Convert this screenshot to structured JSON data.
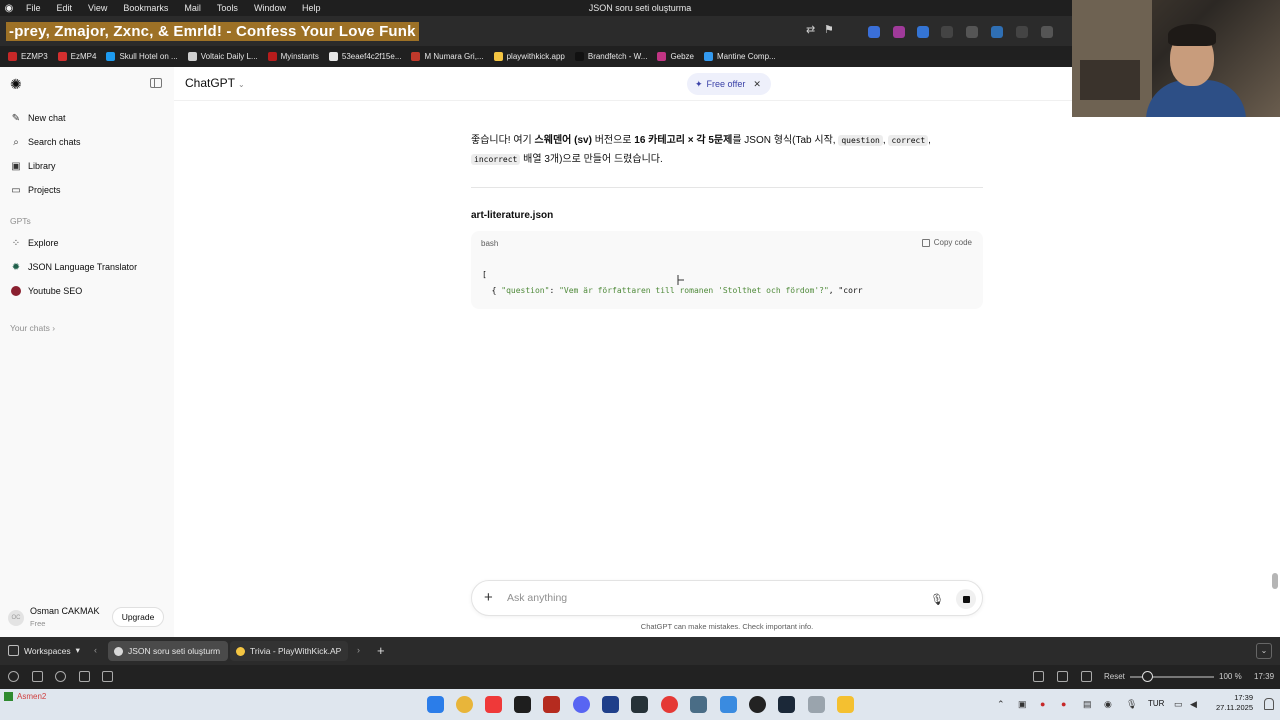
{
  "os_menubar": {
    "items": [
      "File",
      "Edit",
      "View",
      "Bookmarks",
      "Mail",
      "Tools",
      "Window",
      "Help"
    ],
    "window_title": "JSON soru seti oluşturma"
  },
  "now_playing": "-prey, Zmajor, Zxnc, & Emrld! - Confess Your Love Funk",
  "bookmarks": [
    {
      "label": "EZMP3",
      "color": "#c62828"
    },
    {
      "label": "EzMP4",
      "color": "#d32f2f"
    },
    {
      "label": "Skull Hotel on ...",
      "color": "#1d9bf0"
    },
    {
      "label": "Voltaic Daily L...",
      "color": "#cfcfcf"
    },
    {
      "label": "Myinstants",
      "color": "#b71c1c"
    },
    {
      "label": "53eaef4c2f15e...",
      "color": "#e6e6e6"
    },
    {
      "label": "M Numara Gri,...",
      "color": "#c0392b"
    },
    {
      "label": "playwithkick.app",
      "color": "#f4c542"
    },
    {
      "label": "Brandfetch - W...",
      "color": "#111111"
    },
    {
      "label": "Gebze",
      "color": "#c13584"
    },
    {
      "label": "Mantine Comp...",
      "color": "#339af0"
    }
  ],
  "sidebar": {
    "items": [
      {
        "label": "New chat",
        "icon": "pencil-square-icon"
      },
      {
        "label": "Search chats",
        "icon": "search-icon"
      },
      {
        "label": "Library",
        "icon": "library-icon"
      },
      {
        "label": "Projects",
        "icon": "folder-icon"
      }
    ],
    "gpts_heading": "GPTs",
    "gpts": [
      {
        "label": "Explore",
        "icon": "grid-icon"
      },
      {
        "label": "JSON Language Translator",
        "icon": "translator-gpt-icon"
      },
      {
        "label": "Youtube SEO",
        "icon": "youtube-seo-gpt-icon"
      }
    ],
    "your_chats": "Your chats",
    "user": {
      "initials": "OC",
      "name": "Osman CAKMAK",
      "plan": "Free",
      "upgrade": "Upgrade"
    }
  },
  "header": {
    "model": "ChatGPT",
    "offer": "Free offer"
  },
  "message": {
    "part1": "좋습니다! 여기 ",
    "bold1": "스웨덴어 (sv)",
    "part2": " 버전으로 ",
    "bold2": "16 카테고리 × 각 5문제",
    "part3": "를 JSON 형식(Tab 시작, ",
    "code1": "question",
    "sep1": ", ",
    "code2": "correct",
    "sep2": ",",
    "code3": "incorrect",
    "part4": " 배열 3개)으로 만들어 드렸습니다."
  },
  "file": {
    "title": "art-literature.json",
    "lang": "bash",
    "copy_label": "Copy code",
    "line1": "[",
    "line2_indent": "  { ",
    "line2_key": "\"question\"",
    "line2_colon": ": ",
    "line2_value": "\"Vem är författaren till romanen 'Stolthet och fördom'?\"",
    "line2_rest": ", \"corr"
  },
  "composer": {
    "placeholder": "Ask anything",
    "disclaimer": "ChatGPT can make mistakes. Check important info."
  },
  "tabbar": {
    "workspaces": "Workspaces",
    "tabs": [
      {
        "label": "JSON soru seti oluşturm",
        "active": true
      },
      {
        "label": "Trivia - PlayWithKick.AP",
        "active": false
      }
    ]
  },
  "statusbar": {
    "reset": "Reset",
    "zoom": "100 %",
    "time": "17:39"
  },
  "taskbar": {
    "label": "Asmen2",
    "lang": "TUR",
    "time": "17:39",
    "date": "27.11.2025"
  }
}
